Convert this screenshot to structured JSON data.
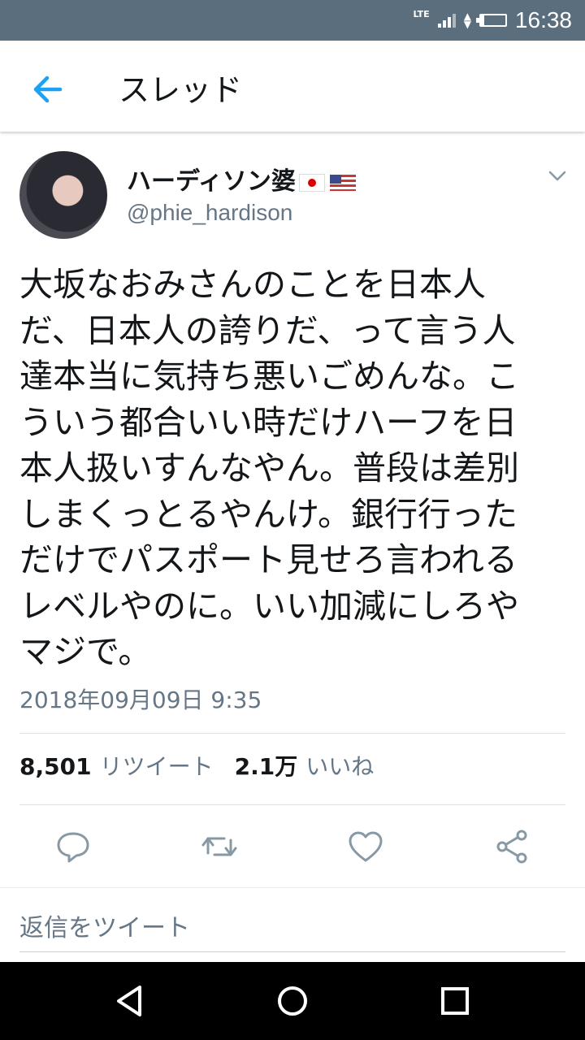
{
  "status_bar": {
    "network": "LTE",
    "time": "16:38"
  },
  "header": {
    "title": "スレッド"
  },
  "tweet": {
    "display_name": "ハーディソン婆",
    "handle": "@phie_hardison",
    "text": "大坂なおみさんのことを日本人\nだ、日本人の誇りだ、って言う人\n達本当に気持ち悪いごめんな。こ\nういう都合いい時だけハーフを日\n本人扱いすんなやん。普段は差別\nしまくっとるやんけ。銀行行った\nだけでパスポート見せろ言われる\nレベルやのに。いい加減にしろや\nマジで。",
    "timestamp": "2018年09月09日 9:35",
    "retweet_count": "8,501",
    "retweet_label": "リツイート",
    "like_count": "2.1万",
    "like_label": "いいね"
  },
  "actions": {
    "icons": [
      "reply-icon",
      "retweet-icon",
      "like-icon",
      "share-icon"
    ]
  },
  "reply": {
    "placeholder": "返信をツイート"
  },
  "colors": {
    "status_bar": "#5b6e7d",
    "accent": "#1da1f2",
    "secondary_text": "#657786",
    "primary_text": "#14171a"
  }
}
